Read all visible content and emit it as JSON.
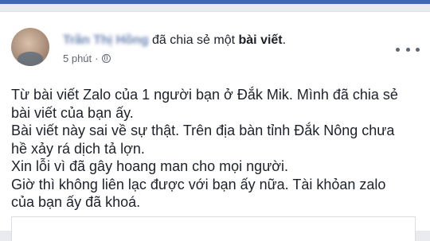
{
  "post": {
    "author_name": "Trần Thị Hồng",
    "verb": " đã chia sẻ một ",
    "object": "bài viết",
    "punctuation": ".",
    "time": "5 phút",
    "separator": "·",
    "privacy_icon": "globe-icon",
    "menu_icon": "more-options-icon",
    "lines": [
      "Từ bài viết Zalo của 1 người bạn ở Đắk Mik. Mình đã chia sẻ",
      "bài viết của bạn ấy.",
      "Bài viết này sai về sự thật. Trên địa bàn tỉnh Đắk Nông chưa",
      "hề xảy rá dịch tả lợn.",
      "Xin lỗi vì đã gây hoang man cho mọi người.",
      "Giờ thì không liên lạc được với bạn ấy nữa. Tài khỏan zalo",
      "của bạn ấy đã khoá."
    ]
  },
  "colors": {
    "brand": "#4267b2",
    "link": "#385898",
    "text": "#1d2129",
    "meta": "#616770"
  }
}
